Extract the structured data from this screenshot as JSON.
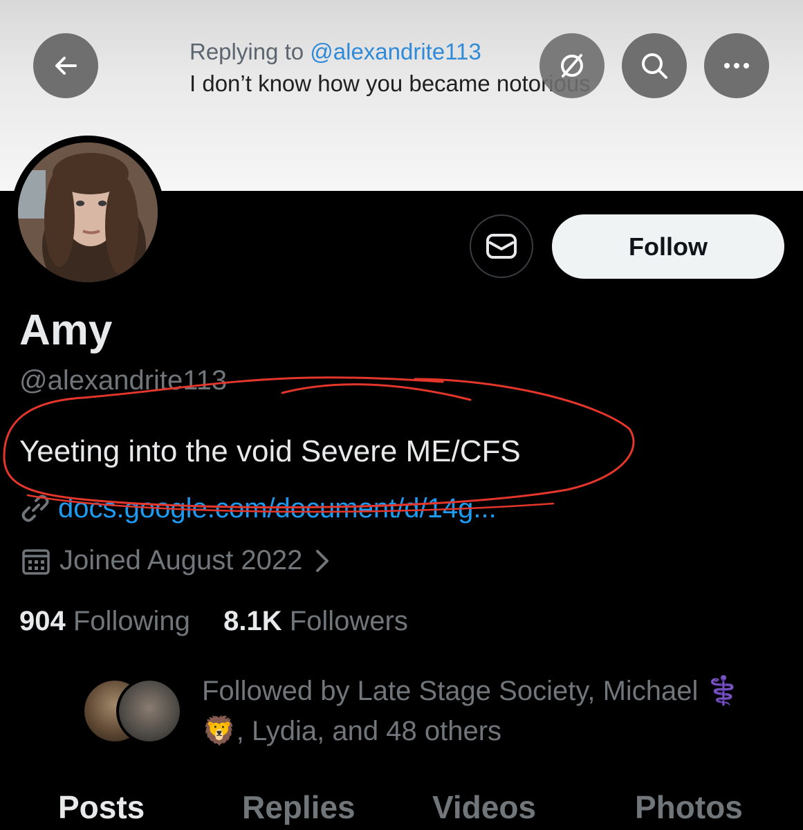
{
  "header": {
    "reply_prefix": "Replying to ",
    "reply_handle": "@alexandrite113",
    "reply_text": "I don’t know how you became notorious"
  },
  "profile": {
    "name": "Amy",
    "handle": "@alexandrite113",
    "bio": "Yeeting into the void Severe ME/CFS",
    "link": "docs.google.com/document/d/14g...",
    "joined": "Joined August 2022",
    "following_count": "904",
    "following_label": "Following",
    "followers_count": "8.1K",
    "followers_label": "Followers",
    "followed_by_line1": "Followed by Late Stage Society, Michael ⚕️",
    "followed_by_line2": "🦁, Lydia, and 48 others"
  },
  "actions": {
    "follow_label": "Follow"
  },
  "tabs": [
    "Posts",
    "Replies",
    "Videos",
    "Photos"
  ],
  "colors": {
    "accent_blue": "#1d9bf0",
    "annotation_red": "#e5362c"
  }
}
